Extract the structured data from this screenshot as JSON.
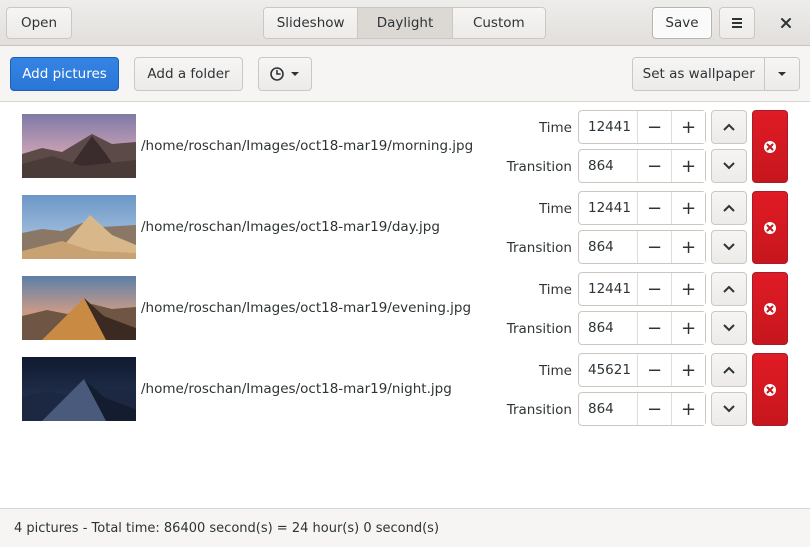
{
  "header": {
    "open_label": "Open",
    "tabs": [
      {
        "label": "Slideshow",
        "active": false
      },
      {
        "label": "Daylight",
        "active": true
      },
      {
        "label": "Custom",
        "active": false
      }
    ],
    "save_label": "Save",
    "menu_icon": "hamburger-menu-icon",
    "close_icon": "close-icon"
  },
  "toolbar": {
    "add_pictures_label": "Add pictures",
    "add_folder_label": "Add a folder",
    "clock_icon": "clock-icon",
    "set_wallpaper_label": "Set as wallpaper",
    "accent_color": "#3584e4"
  },
  "list": {
    "time_label": "Time",
    "transition_label": "Transition",
    "items": [
      {
        "path": "/home/roschan/Images/oct18-mar19/morning.jpg",
        "time": "12441",
        "transition": "864",
        "thumbnail": "desert-dunes-morning"
      },
      {
        "path": "/home/roschan/Images/oct18-mar19/day.jpg",
        "time": "12441",
        "transition": "864",
        "thumbnail": "desert-dunes-day"
      },
      {
        "path": "/home/roschan/Images/oct18-mar19/evening.jpg",
        "time": "12441",
        "transition": "864",
        "thumbnail": "desert-dunes-evening"
      },
      {
        "path": "/home/roschan/Images/oct18-mar19/night.jpg",
        "time": "45621",
        "transition": "864",
        "thumbnail": "desert-dunes-night"
      }
    ],
    "remove_color": "#e01b24"
  },
  "status": {
    "text": "4 pictures - Total time: 86400 second(s) = 24 hour(s) 0 second(s)"
  }
}
